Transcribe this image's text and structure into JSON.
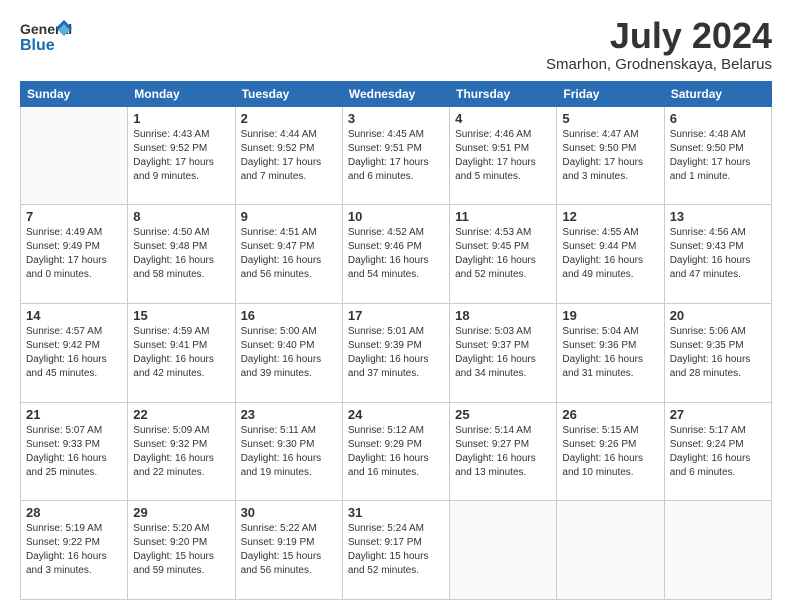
{
  "logo": {
    "line1": "General",
    "line2": "Blue"
  },
  "title": "July 2024",
  "subtitle": "Smarhon, Grodnenskaya, Belarus",
  "days_header": [
    "Sunday",
    "Monday",
    "Tuesday",
    "Wednesday",
    "Thursday",
    "Friday",
    "Saturday"
  ],
  "weeks": [
    [
      {
        "num": "",
        "info": ""
      },
      {
        "num": "1",
        "info": "Sunrise: 4:43 AM\nSunset: 9:52 PM\nDaylight: 17 hours\nand 9 minutes."
      },
      {
        "num": "2",
        "info": "Sunrise: 4:44 AM\nSunset: 9:52 PM\nDaylight: 17 hours\nand 7 minutes."
      },
      {
        "num": "3",
        "info": "Sunrise: 4:45 AM\nSunset: 9:51 PM\nDaylight: 17 hours\nand 6 minutes."
      },
      {
        "num": "4",
        "info": "Sunrise: 4:46 AM\nSunset: 9:51 PM\nDaylight: 17 hours\nand 5 minutes."
      },
      {
        "num": "5",
        "info": "Sunrise: 4:47 AM\nSunset: 9:50 PM\nDaylight: 17 hours\nand 3 minutes."
      },
      {
        "num": "6",
        "info": "Sunrise: 4:48 AM\nSunset: 9:50 PM\nDaylight: 17 hours\nand 1 minute."
      }
    ],
    [
      {
        "num": "7",
        "info": "Sunrise: 4:49 AM\nSunset: 9:49 PM\nDaylight: 17 hours\nand 0 minutes."
      },
      {
        "num": "8",
        "info": "Sunrise: 4:50 AM\nSunset: 9:48 PM\nDaylight: 16 hours\nand 58 minutes."
      },
      {
        "num": "9",
        "info": "Sunrise: 4:51 AM\nSunset: 9:47 PM\nDaylight: 16 hours\nand 56 minutes."
      },
      {
        "num": "10",
        "info": "Sunrise: 4:52 AM\nSunset: 9:46 PM\nDaylight: 16 hours\nand 54 minutes."
      },
      {
        "num": "11",
        "info": "Sunrise: 4:53 AM\nSunset: 9:45 PM\nDaylight: 16 hours\nand 52 minutes."
      },
      {
        "num": "12",
        "info": "Sunrise: 4:55 AM\nSunset: 9:44 PM\nDaylight: 16 hours\nand 49 minutes."
      },
      {
        "num": "13",
        "info": "Sunrise: 4:56 AM\nSunset: 9:43 PM\nDaylight: 16 hours\nand 47 minutes."
      }
    ],
    [
      {
        "num": "14",
        "info": "Sunrise: 4:57 AM\nSunset: 9:42 PM\nDaylight: 16 hours\nand 45 minutes."
      },
      {
        "num": "15",
        "info": "Sunrise: 4:59 AM\nSunset: 9:41 PM\nDaylight: 16 hours\nand 42 minutes."
      },
      {
        "num": "16",
        "info": "Sunrise: 5:00 AM\nSunset: 9:40 PM\nDaylight: 16 hours\nand 39 minutes."
      },
      {
        "num": "17",
        "info": "Sunrise: 5:01 AM\nSunset: 9:39 PM\nDaylight: 16 hours\nand 37 minutes."
      },
      {
        "num": "18",
        "info": "Sunrise: 5:03 AM\nSunset: 9:37 PM\nDaylight: 16 hours\nand 34 minutes."
      },
      {
        "num": "19",
        "info": "Sunrise: 5:04 AM\nSunset: 9:36 PM\nDaylight: 16 hours\nand 31 minutes."
      },
      {
        "num": "20",
        "info": "Sunrise: 5:06 AM\nSunset: 9:35 PM\nDaylight: 16 hours\nand 28 minutes."
      }
    ],
    [
      {
        "num": "21",
        "info": "Sunrise: 5:07 AM\nSunset: 9:33 PM\nDaylight: 16 hours\nand 25 minutes."
      },
      {
        "num": "22",
        "info": "Sunrise: 5:09 AM\nSunset: 9:32 PM\nDaylight: 16 hours\nand 22 minutes."
      },
      {
        "num": "23",
        "info": "Sunrise: 5:11 AM\nSunset: 9:30 PM\nDaylight: 16 hours\nand 19 minutes."
      },
      {
        "num": "24",
        "info": "Sunrise: 5:12 AM\nSunset: 9:29 PM\nDaylight: 16 hours\nand 16 minutes."
      },
      {
        "num": "25",
        "info": "Sunrise: 5:14 AM\nSunset: 9:27 PM\nDaylight: 16 hours\nand 13 minutes."
      },
      {
        "num": "26",
        "info": "Sunrise: 5:15 AM\nSunset: 9:26 PM\nDaylight: 16 hours\nand 10 minutes."
      },
      {
        "num": "27",
        "info": "Sunrise: 5:17 AM\nSunset: 9:24 PM\nDaylight: 16 hours\nand 6 minutes."
      }
    ],
    [
      {
        "num": "28",
        "info": "Sunrise: 5:19 AM\nSunset: 9:22 PM\nDaylight: 16 hours\nand 3 minutes."
      },
      {
        "num": "29",
        "info": "Sunrise: 5:20 AM\nSunset: 9:20 PM\nDaylight: 15 hours\nand 59 minutes."
      },
      {
        "num": "30",
        "info": "Sunrise: 5:22 AM\nSunset: 9:19 PM\nDaylight: 15 hours\nand 56 minutes."
      },
      {
        "num": "31",
        "info": "Sunrise: 5:24 AM\nSunset: 9:17 PM\nDaylight: 15 hours\nand 52 minutes."
      },
      {
        "num": "",
        "info": ""
      },
      {
        "num": "",
        "info": ""
      },
      {
        "num": "",
        "info": ""
      }
    ]
  ]
}
